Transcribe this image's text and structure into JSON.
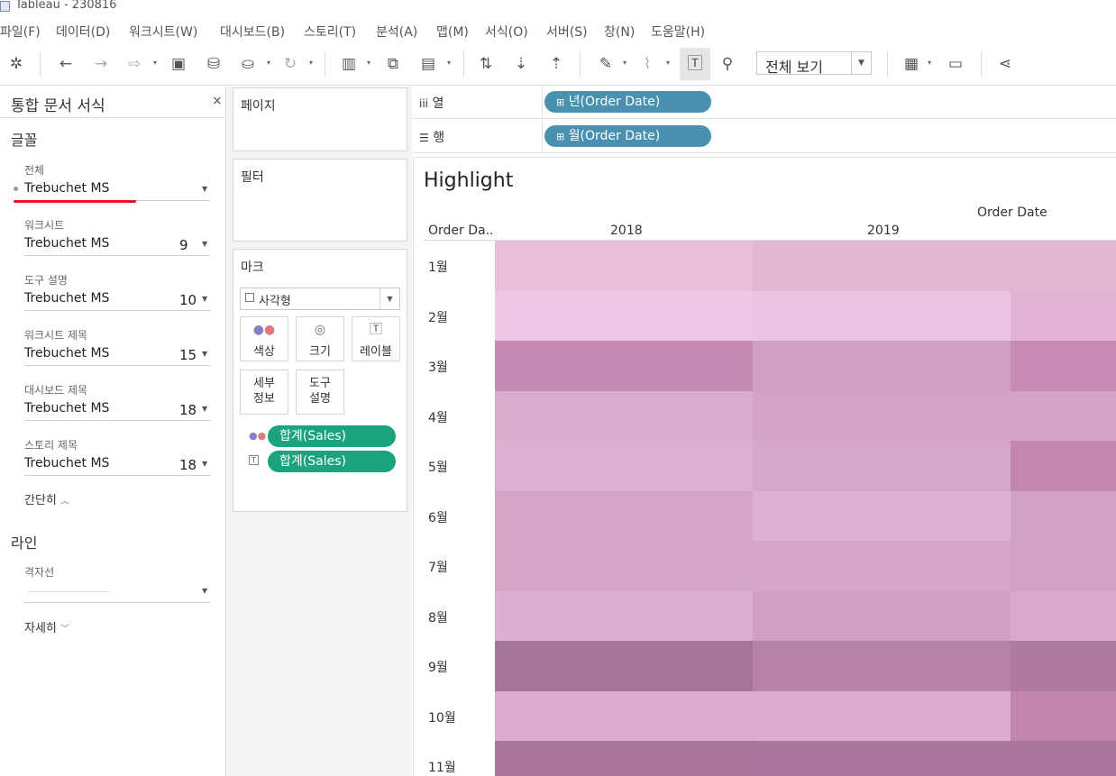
{
  "window": {
    "title": "Tableau - 230816"
  },
  "menu": [
    "파일(F)",
    "데이터(D)",
    "워크시트(W)",
    "대시보드(B)",
    "스토리(T)",
    "분석(A)",
    "맵(M)",
    "서식(O)",
    "서버(S)",
    "창(N)",
    "도움말(H)"
  ],
  "toolbar": {
    "icons": [
      "tableau-logo-icon",
      "back-icon",
      "forward-icon",
      "redo-icon",
      "save-icon",
      "new-datasource-icon",
      "pause-updates-icon",
      "refresh-icon",
      "new-worksheet-icon",
      "duplicate-sheet-icon",
      "clear-sheet-icon",
      "swap-rows-cols-icon",
      "sort-ascending-icon",
      "sort-descending-icon",
      "highlight-icon",
      "attach-icon",
      "show-labels-icon",
      "pin-icon",
      "show-me-icon",
      "presentation-icon",
      "share-icon"
    ],
    "fit": "전체 보기"
  },
  "format_pane": {
    "title": "통합 문서 서식",
    "close": "×",
    "font_section": "글꼴",
    "rows": [
      {
        "label": "전체",
        "font": "Trebuchet MS",
        "size": ""
      },
      {
        "label": "워크시트",
        "font": "Trebuchet MS",
        "size": "9"
      },
      {
        "label": "도구 설명",
        "font": "Trebuchet MS",
        "size": "10"
      },
      {
        "label": "워크시트 제목",
        "font": "Trebuchet MS",
        "size": "15"
      },
      {
        "label": "대시보드 제목",
        "font": "Trebuchet MS",
        "size": "18"
      },
      {
        "label": "스토리 제목",
        "font": "Trebuchet MS",
        "size": "18"
      }
    ],
    "less": "간단히",
    "lines_section": "라인",
    "gridlines_label": "격자선",
    "more": "자세히"
  },
  "cards": {
    "pages": "페이지",
    "filters": "필터",
    "marks": "마크",
    "mark_type": "사각형",
    "buttons": {
      "color": "색상",
      "size": "크기",
      "label": "레이블",
      "detail_1": "세부",
      "detail_2": "정보",
      "tooltip_1": "도구",
      "tooltip_2": "설명"
    },
    "fields": [
      "합계(Sales)",
      "합계(Sales)"
    ]
  },
  "shelves": {
    "columns": {
      "label": "열",
      "pill": "년(Order Date)"
    },
    "rows": {
      "label": "행",
      "pill": "월(Order Date)"
    }
  },
  "view": {
    "title": "Highlight",
    "col_field": "Order Date",
    "row_field": "Order Da..",
    "columns": [
      "2018",
      "2019"
    ],
    "rows": [
      "1월",
      "2월",
      "3월",
      "4월",
      "5월",
      "6월",
      "7월",
      "8월",
      "9월",
      "10월",
      "11월"
    ],
    "colors": [
      [
        "#e8bedb",
        "#e4b8d5",
        "#e3b6d4"
      ],
      [
        "#edc8e4",
        "#ebc2df",
        "#e4b3d4"
      ],
      [
        "#c48ab1",
        "#d19fc0",
        "#c78bb3"
      ],
      [
        "#daaccc",
        "#d3a2c4",
        "#d4a3c4"
      ],
      [
        "#dcb0d0",
        "#d6a8c8",
        "#c387ad"
      ],
      [
        "#d5a5c5",
        "#deb0d2",
        "#d3a1c2"
      ],
      [
        "#d5a5c5",
        "#d6a5c6",
        "#d3a1c2"
      ],
      [
        "#dcaed0",
        "#d0a0c2",
        "#d9a9cb"
      ],
      [
        "#a67597",
        "#b882a6",
        "#ae7a9e"
      ],
      [
        "#dbaccd",
        "#dbaccd",
        "#c286ad"
      ],
      [
        "#a97599",
        "#aa769b",
        "#aa769b"
      ]
    ]
  }
}
